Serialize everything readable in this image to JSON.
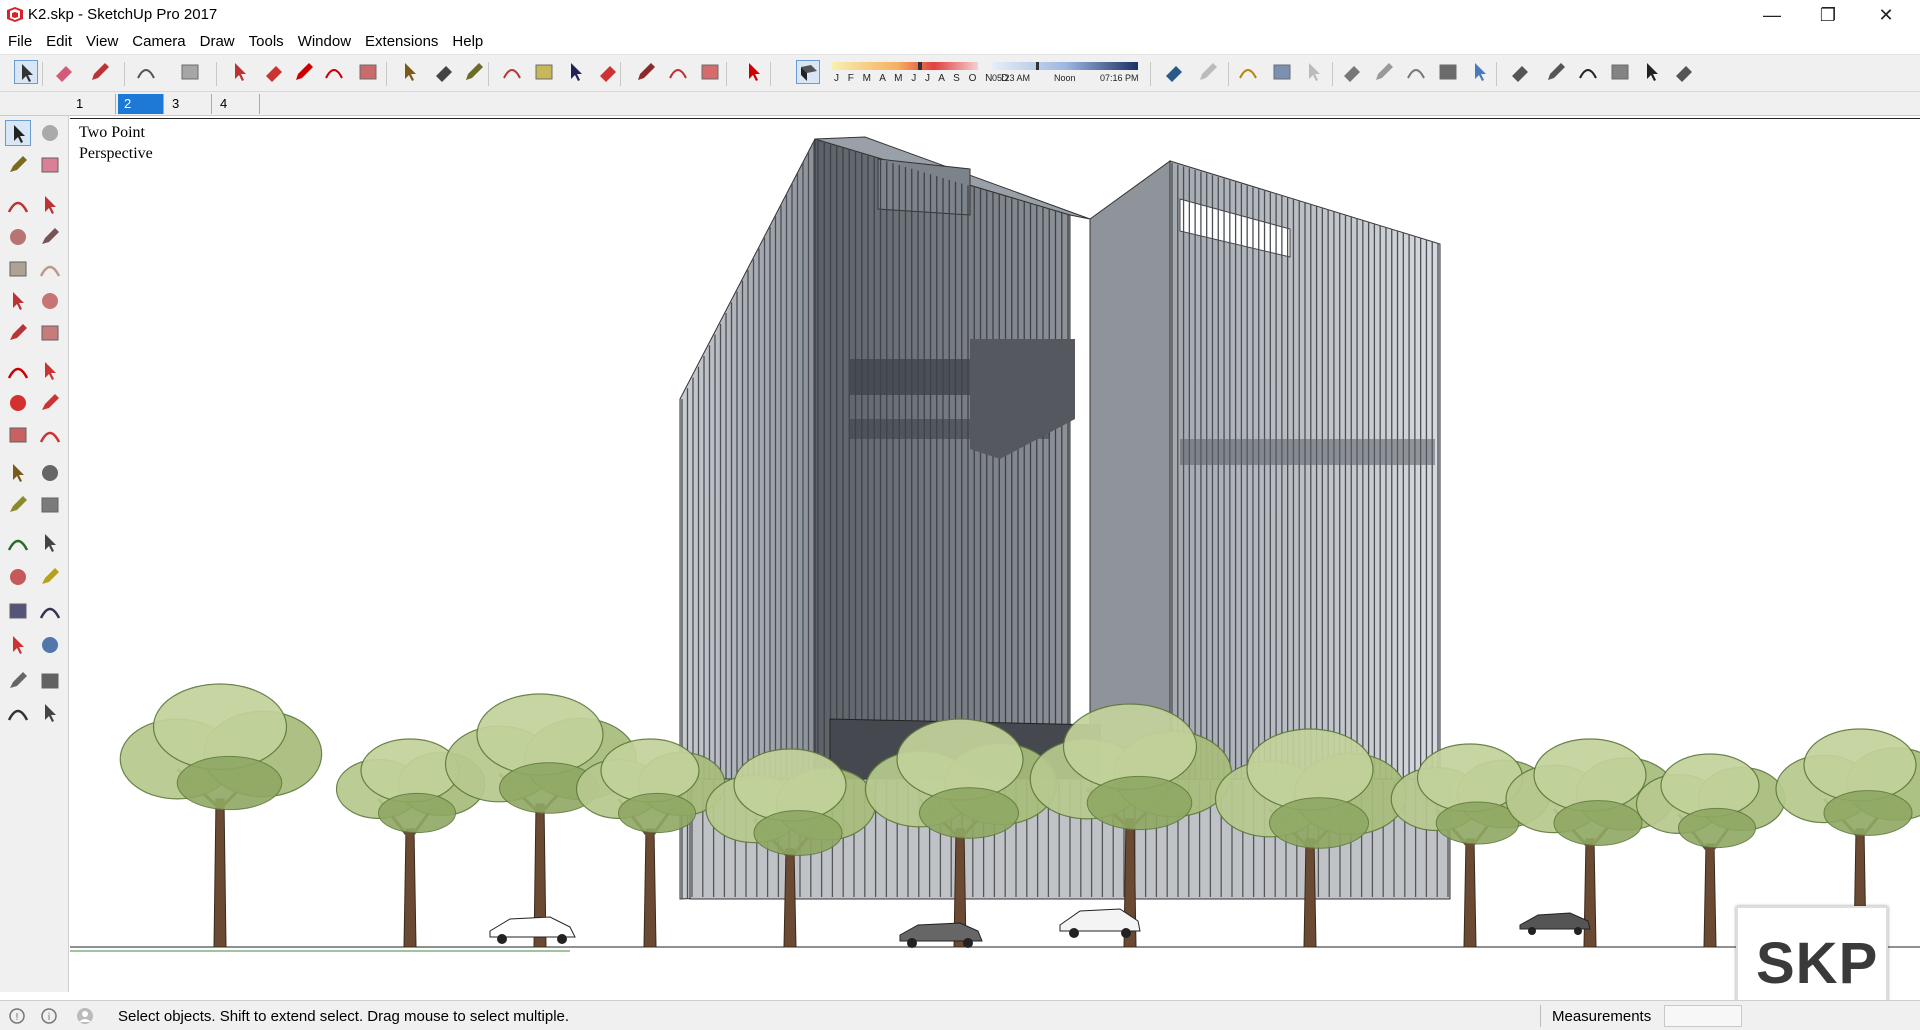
{
  "window": {
    "title": "K2.skp - SketchUp Pro 2017",
    "minimize_glyph": "—",
    "maximize_glyph": "❐",
    "close_glyph": "✕"
  },
  "menu": [
    "File",
    "Edit",
    "View",
    "Camera",
    "Draw",
    "Tools",
    "Window",
    "Extensions",
    "Help"
  ],
  "toolbar": {
    "shadow_months": "J F M A M J J A S O N D",
    "sunrise_time": "05:23 AM",
    "noon_label": "Noon",
    "sunset_time": "07:16 PM",
    "icons": [
      "select-icon",
      "eraser-icon",
      "pencil-icon",
      "arc-icon",
      "rectangle-icon",
      "push-pull-icon",
      "follow-me-icon",
      "move-icon",
      "rotate-icon",
      "scale-icon",
      "tape-measure-icon",
      "text-icon",
      "paint-bucket-icon",
      "orbit-icon",
      "pan-icon",
      "zoom-icon",
      "zoom-extents-icon",
      "warehouse-icon",
      "extension-warehouse-icon",
      "layout-icon",
      "ruby-icon",
      "shadows-icon",
      "fog-icon",
      "section-plane-icon",
      "xray-icon",
      "back-edges-icon",
      "wireframe-icon",
      "hidden-line-icon",
      "shaded-icon",
      "shaded-textures-icon",
      "monochrome-icon",
      "iso-view-icon",
      "top-view-icon",
      "front-view-icon",
      "right-view-icon",
      "back-view-icon",
      "left-view-icon"
    ]
  },
  "scenes": {
    "tabs": [
      "1",
      "2",
      "3",
      "4"
    ],
    "active": "2"
  },
  "viewport": {
    "camera_label_line1": "Two Point",
    "camera_label_line2": "Perspective"
  },
  "status": {
    "message": "Select objects. Shift to extend select. Drag mouse to select multiple.",
    "measurements_label": "Measurements",
    "measurements_value": ""
  },
  "watermark": {
    "text": "SKP"
  },
  "colors": {
    "accent": "#1d79d5",
    "foliage_light": "#b7c98e",
    "foliage_dark": "#5f7a3c",
    "building_glass": "#7b8088",
    "trunk": "#6b4a34"
  }
}
